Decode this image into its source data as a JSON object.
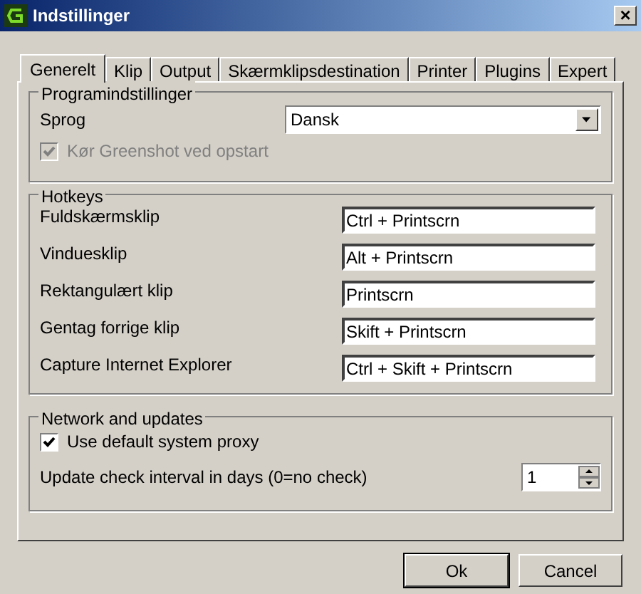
{
  "window": {
    "title": "Indstillinger",
    "close": "×"
  },
  "tabs": [
    {
      "label": "Generelt",
      "selected": true
    },
    {
      "label": "Klip",
      "selected": false
    },
    {
      "label": "Output",
      "selected": false
    },
    {
      "label": "Skærmklipsdestination",
      "selected": false
    },
    {
      "label": "Printer",
      "selected": false
    },
    {
      "label": "Plugins",
      "selected": false
    },
    {
      "label": "Expert",
      "selected": false
    }
  ],
  "program": {
    "title": "Programindstillinger",
    "language_label": "Sprog",
    "language": "Dansk",
    "startup": {
      "label": "Kør Greenshot ved opstart",
      "checked": true,
      "disabled": true
    }
  },
  "hotkeys": {
    "title": "Hotkeys",
    "rows": [
      {
        "label": "Fuldskærmsklip",
        "value": "Ctrl + Printscrn"
      },
      {
        "label": "Vinduesklip",
        "value": "Alt + Printscrn"
      },
      {
        "label": "Rektangulært klip",
        "value": "Printscrn"
      },
      {
        "label": "Gentag forrige klip",
        "value": "Skift + Printscrn"
      },
      {
        "label": "Capture Internet Explorer",
        "value": "Ctrl + Skift + Printscrn"
      }
    ]
  },
  "network": {
    "title": "Network and updates",
    "proxy": {
      "label": "Use default system proxy",
      "checked": true,
      "disabled": false
    },
    "interval_label": "Update check interval in days (0=no check)",
    "interval": "1"
  },
  "buttons": [
    {
      "label": "Ok",
      "default": true
    },
    {
      "label": "Cancel",
      "default": false
    }
  ]
}
